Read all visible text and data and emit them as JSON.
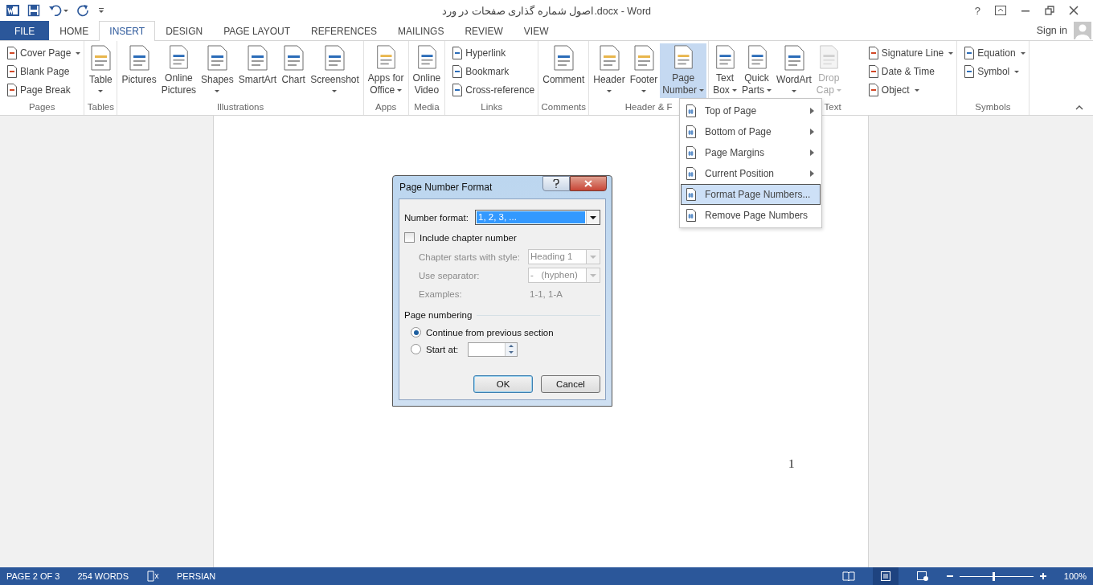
{
  "title_bar": {
    "title": "اصول شماره گذاری صفحات در ورد.docx - Word",
    "help": "?",
    "sign_in": "Sign in"
  },
  "tabs": [
    {
      "label": "FILE",
      "kind": "file",
      "selected": false
    },
    {
      "label": "HOME",
      "kind": "tab",
      "selected": false
    },
    {
      "label": "INSERT",
      "kind": "tab",
      "selected": true
    },
    {
      "label": "DESIGN",
      "kind": "tab",
      "selected": false
    },
    {
      "label": "PAGE LAYOUT",
      "kind": "tab",
      "selected": false
    },
    {
      "label": "REFERENCES",
      "kind": "tab",
      "selected": false
    },
    {
      "label": "MAILINGS",
      "kind": "tab",
      "selected": false
    },
    {
      "label": "REVIEW",
      "kind": "tab",
      "selected": false
    },
    {
      "label": "VIEW",
      "kind": "tab",
      "selected": false
    }
  ],
  "ribbon": {
    "groups": [
      {
        "label": "Pages",
        "items": [
          {
            "kind": "small",
            "label": [
              "Cover Page"
            ],
            "dropdown": true,
            "selected": false,
            "disabled": false
          },
          {
            "kind": "small",
            "label": [
              "Blank Page"
            ],
            "dropdown": false,
            "selected": false,
            "disabled": false
          },
          {
            "kind": "small",
            "label": [
              "Page Break"
            ],
            "dropdown": false,
            "selected": false,
            "disabled": false
          }
        ]
      },
      {
        "label": "Tables",
        "items": [
          {
            "kind": "large",
            "label": [
              "Table"
            ],
            "dropdown": true,
            "selected": false,
            "disabled": false
          }
        ]
      },
      {
        "label": "Illustrations",
        "items": [
          {
            "kind": "large",
            "label": [
              "Pictures"
            ],
            "dropdown": false,
            "selected": false,
            "disabled": false
          },
          {
            "kind": "large",
            "label": [
              "Online",
              "Pictures"
            ],
            "dropdown": false,
            "selected": false,
            "disabled": false
          },
          {
            "kind": "large",
            "label": [
              "Shapes"
            ],
            "dropdown": true,
            "selected": false,
            "disabled": false
          },
          {
            "kind": "large",
            "label": [
              "SmartArt"
            ],
            "dropdown": false,
            "selected": false,
            "disabled": false
          },
          {
            "kind": "large",
            "label": [
              "Chart"
            ],
            "dropdown": false,
            "selected": false,
            "disabled": false
          },
          {
            "kind": "large",
            "label": [
              "Screenshot"
            ],
            "dropdown": true,
            "selected": false,
            "disabled": false
          }
        ]
      },
      {
        "label": "Apps",
        "items": [
          {
            "kind": "large",
            "label": [
              "Apps for",
              "Office"
            ],
            "dropdown": true,
            "selected": false,
            "disabled": false
          }
        ]
      },
      {
        "label": "Media",
        "items": [
          {
            "kind": "large",
            "label": [
              "Online",
              "Video"
            ],
            "dropdown": false,
            "selected": false,
            "disabled": false
          }
        ]
      },
      {
        "label": "Links",
        "items": [
          {
            "kind": "small",
            "label": [
              "Hyperlink"
            ],
            "dropdown": false,
            "selected": false,
            "disabled": false
          },
          {
            "kind": "small",
            "label": [
              "Bookmark"
            ],
            "dropdown": false,
            "selected": false,
            "disabled": false
          },
          {
            "kind": "small",
            "label": [
              "Cross-reference"
            ],
            "dropdown": false,
            "selected": false,
            "disabled": false
          }
        ]
      },
      {
        "label": "Comments",
        "items": [
          {
            "kind": "large",
            "label": [
              "Comment"
            ],
            "dropdown": false,
            "selected": false,
            "disabled": false
          }
        ]
      },
      {
        "label": "Header & F",
        "items": [
          {
            "kind": "large",
            "label": [
              "Header"
            ],
            "dropdown": true,
            "selected": false,
            "disabled": false
          },
          {
            "kind": "large",
            "label": [
              "Footer"
            ],
            "dropdown": true,
            "selected": false,
            "disabled": false
          },
          {
            "kind": "large",
            "label": [
              "Page",
              "Number"
            ],
            "dropdown": true,
            "selected": true,
            "disabled": false
          }
        ]
      },
      {
        "label": "Text",
        "items": [
          {
            "kind": "large",
            "label": [
              "Text",
              "Box"
            ],
            "dropdown": true,
            "selected": false,
            "disabled": false
          },
          {
            "kind": "large",
            "label": [
              "Quick",
              "Parts"
            ],
            "dropdown": true,
            "selected": false,
            "disabled": false
          },
          {
            "kind": "large",
            "label": [
              "WordArt"
            ],
            "dropdown": true,
            "selected": false,
            "disabled": false
          },
          {
            "kind": "large",
            "label": [
              "Drop",
              "Cap"
            ],
            "dropdown": true,
            "selected": false,
            "disabled": true
          },
          {
            "kind": "small",
            "label": [
              "Signature Line"
            ],
            "dropdown": true,
            "selected": false,
            "disabled": false
          },
          {
            "kind": "small",
            "label": [
              "Date & Time"
            ],
            "dropdown": false,
            "selected": false,
            "disabled": false
          },
          {
            "kind": "small",
            "label": [
              "Object"
            ],
            "dropdown": true,
            "selected": false,
            "disabled": false
          }
        ]
      },
      {
        "label": "Symbols",
        "items": [
          {
            "kind": "small",
            "label": [
              "Equation"
            ],
            "dropdown": true,
            "selected": false,
            "disabled": false
          },
          {
            "kind": "small",
            "label": [
              "Symbol"
            ],
            "dropdown": true,
            "selected": false,
            "disabled": false
          }
        ]
      }
    ]
  },
  "page_number_menu": {
    "items": [
      {
        "label": "Top of Page",
        "submenu": true,
        "selected": false
      },
      {
        "label": "Bottom of Page",
        "submenu": true,
        "selected": false
      },
      {
        "label": "Page Margins",
        "submenu": true,
        "selected": false
      },
      {
        "label": "Current Position",
        "submenu": true,
        "selected": false
      },
      {
        "label": "Format Page Numbers...",
        "submenu": false,
        "selected": true
      },
      {
        "label": "Remove Page Numbers",
        "submenu": false,
        "selected": false
      }
    ]
  },
  "document": {
    "page_number": "1"
  },
  "dialog": {
    "title": "Page Number Format",
    "number_format": {
      "label": "Number format:",
      "value": "1, 2, 3, ..."
    },
    "include_chapter": {
      "label": "Include chapter number",
      "checked": false
    },
    "chapter_style": {
      "label": "Chapter starts with style:",
      "value": "Heading 1",
      "disabled": true
    },
    "separator": {
      "label": "Use separator:",
      "value": "-   (hyphen)",
      "disabled": true
    },
    "examples": {
      "label": "Examples:",
      "value": "1-1, 1-A",
      "disabled": true
    },
    "page_numbering": {
      "heading": "Page numbering",
      "options": [
        {
          "label": "Continue from previous section",
          "selected": true,
          "spin": false
        },
        {
          "label": "Start at:",
          "selected": false,
          "spin": true
        }
      ]
    },
    "buttons": [
      "OK",
      "Cancel"
    ]
  },
  "status_bar": {
    "page": "PAGE 2 OF 3",
    "words": "254 WORDS",
    "language": "PERSIAN",
    "zoom": {
      "level": 0.46,
      "reading": "100%"
    }
  }
}
